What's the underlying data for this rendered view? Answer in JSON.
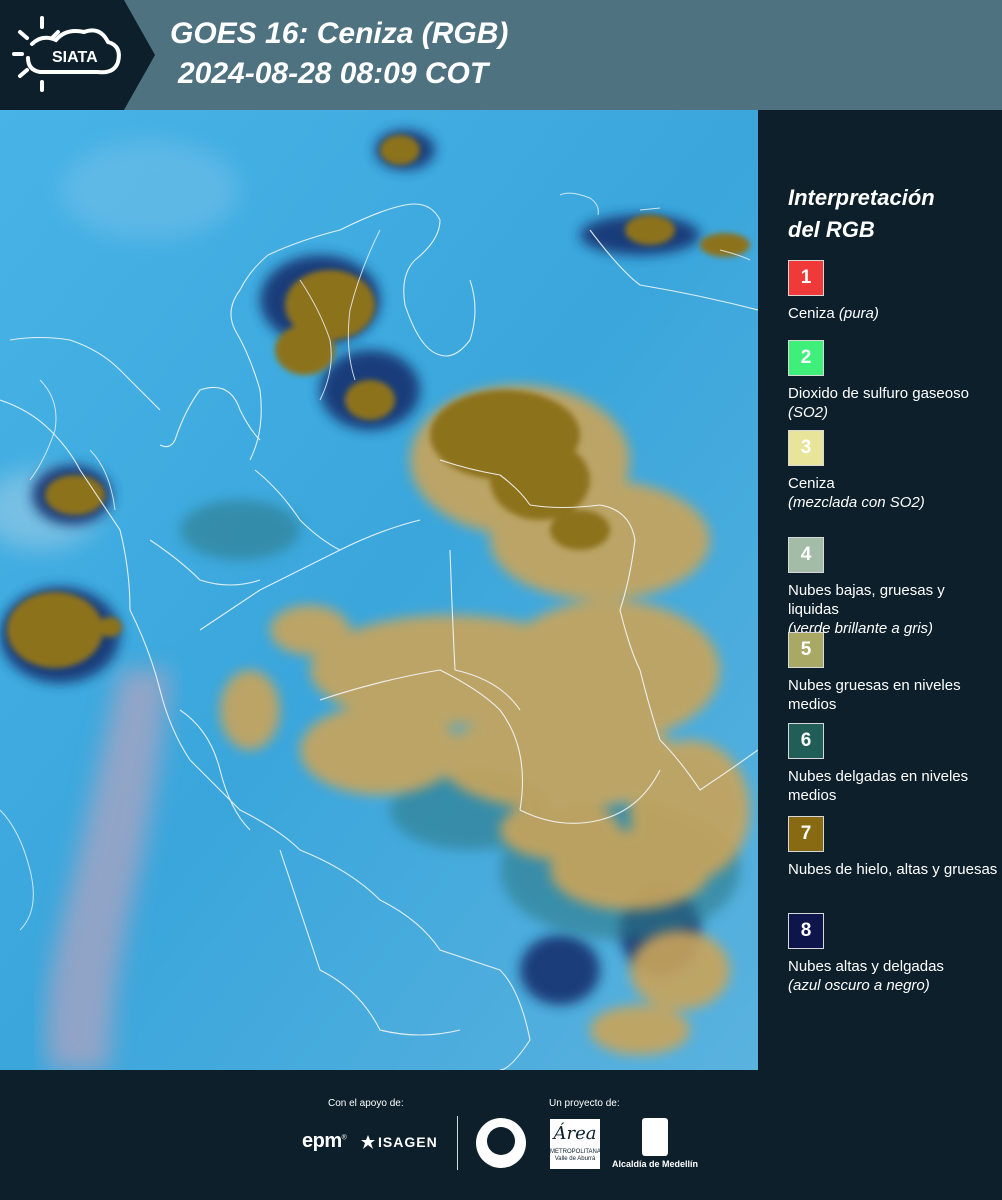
{
  "header": {
    "logo_text": "SIATA",
    "title_line1": "GOES 16: Ceniza (RGB)",
    "title_line2": "2024-08-28 08:09 COT"
  },
  "map": {
    "background_color": "#3fa7dc",
    "cloud_color": "#c8a35a",
    "deep_cloud_color": "#8a6d1f",
    "thin_cloud_color": "#142d73"
  },
  "legend": {
    "title_line1": "Interpretación",
    "title_line2": "del RGB",
    "items": [
      {
        "number": "1",
        "color": "#f03a3a",
        "text": "Ceniza",
        "note": "(pura)"
      },
      {
        "number": "2",
        "color": "#3ef07a",
        "text": "Dioxido de sulfuro gaseoso",
        "note": "(SO2)"
      },
      {
        "number": "3",
        "color": "#e8e49a",
        "text": "Ceniza",
        "note": "(mezclada con SO2)"
      },
      {
        "number": "4",
        "color": "#a3bca8",
        "text": "Nubes bajas, gruesas y liquidas",
        "note": "(verde brillante a gris)"
      },
      {
        "number": "5",
        "color": "#a9a865",
        "text": "Nubes gruesas en niveles medios",
        "note": ""
      },
      {
        "number": "6",
        "color": "#205e57",
        "text": "Nubes delgadas en niveles medios",
        "note": ""
      },
      {
        "number": "7",
        "color": "#876a12",
        "text": "Nubes de hielo, altas y gruesas",
        "note": ""
      },
      {
        "number": "8",
        "color": "#0e154a",
        "text": "Nubes altas y delgadas",
        "note": "(azul oscuro a negro)"
      }
    ]
  },
  "footer": {
    "support_label": "Con el apoyo de:",
    "project_label": "Un proyecto de:",
    "epm": "epm",
    "isagen": "ISAGEN",
    "area_script": "Área",
    "area_text": "METROPOLITANA",
    "area_sub": "Valle de Aburrá",
    "alcaldia": "Alcaldía de Medellín"
  }
}
